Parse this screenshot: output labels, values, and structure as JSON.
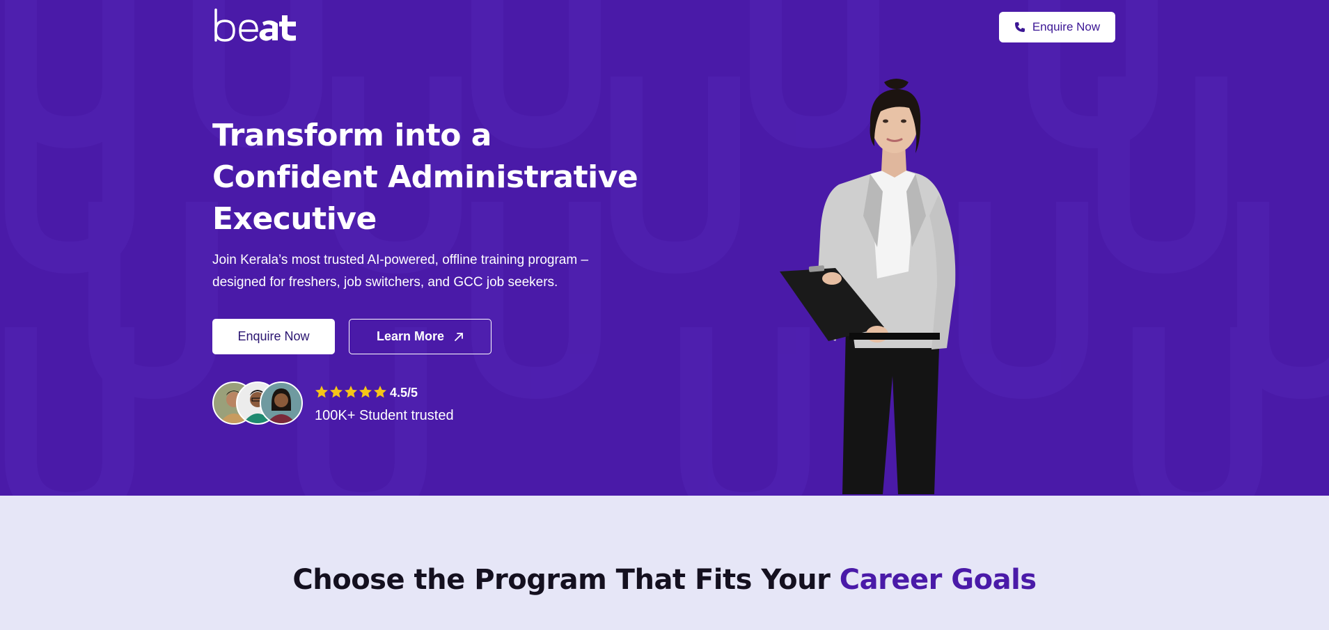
{
  "brand": {
    "logo_text": "beat",
    "primary": "#4a1aa8",
    "accent_star": "#f5c518",
    "light_bg": "#e6e6f7"
  },
  "nav": {
    "cta_label": "Enquire Now",
    "cta_icon": "phone-icon"
  },
  "hero": {
    "headline_lines": [
      "Transform into a",
      "Confident Administrative",
      "Executive"
    ],
    "subtext_lines": [
      "Join Kerala’s most trusted AI-powered, offline training program –",
      "designed for freshers, job switchers, and GCC job seekers."
    ],
    "primary_button": "Enquire Now",
    "secondary_button": "Learn More",
    "secondary_icon": "arrow-up-right-icon",
    "rating": "4.5/5",
    "stars": 5,
    "trusted_text": "100K+ Student trusted"
  },
  "programs": {
    "title_main": "Choose the Program That Fits Your ",
    "title_accent": "Career Goals"
  }
}
